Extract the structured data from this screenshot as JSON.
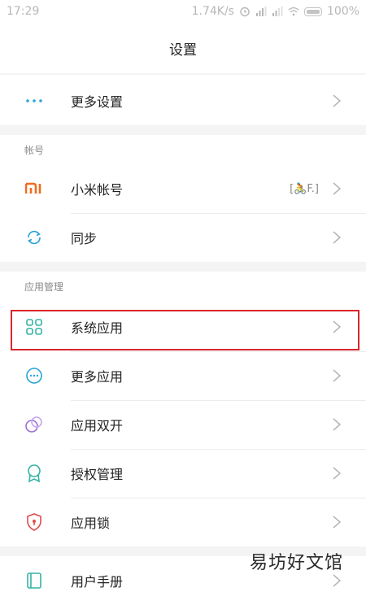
{
  "status": {
    "time": "17:29",
    "speed": "1.74K/s",
    "battery": "100%"
  },
  "title": "设置",
  "rows": {
    "more_settings": "更多设置",
    "mi_account": "小米帐号",
    "mi_account_value": "[🚴F.]",
    "sync": "同步",
    "system_apps": "系统应用",
    "more_apps": "更多应用",
    "dual_apps": "应用双开",
    "permissions": "授权管理",
    "app_lock": "应用锁",
    "user_manual": "用户手册"
  },
  "sections": {
    "account": "帐号",
    "app_management": "应用管理"
  },
  "watermark": "易坊好文馆",
  "colors": {
    "highlight_border": "#d9262c",
    "mi_orange": "#f26b1d",
    "accent_blue": "#2aa3d8",
    "accent_teal": "#36b3a6",
    "accent_purple": "#9b6fd6",
    "accent_red": "#e24a4a"
  },
  "icons": {
    "more_settings": "dots-icon",
    "mi_account": "mi-logo-icon",
    "sync": "sync-icon",
    "system_apps": "grid-icon",
    "more_apps": "more-circle-icon",
    "dual_apps": "dual-circles-icon",
    "permissions": "ribbon-icon",
    "app_lock": "shield-lock-icon",
    "user_manual": "book-icon"
  }
}
